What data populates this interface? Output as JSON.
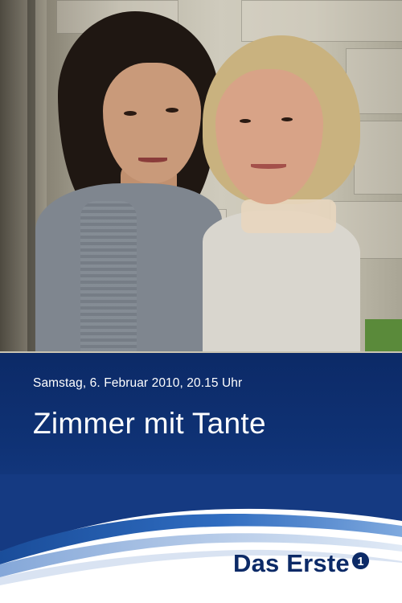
{
  "poster": {
    "airdate": "Samstag, 6. Februar 2010, 20.15 Uhr",
    "title": "Zimmer mit Tante",
    "channel_logo_text": "Das Erste",
    "channel_logo_numeral": "1"
  },
  "colors": {
    "band": "#0c2a67",
    "text_on_band": "#ffffff",
    "logo": "#0c2a67"
  }
}
